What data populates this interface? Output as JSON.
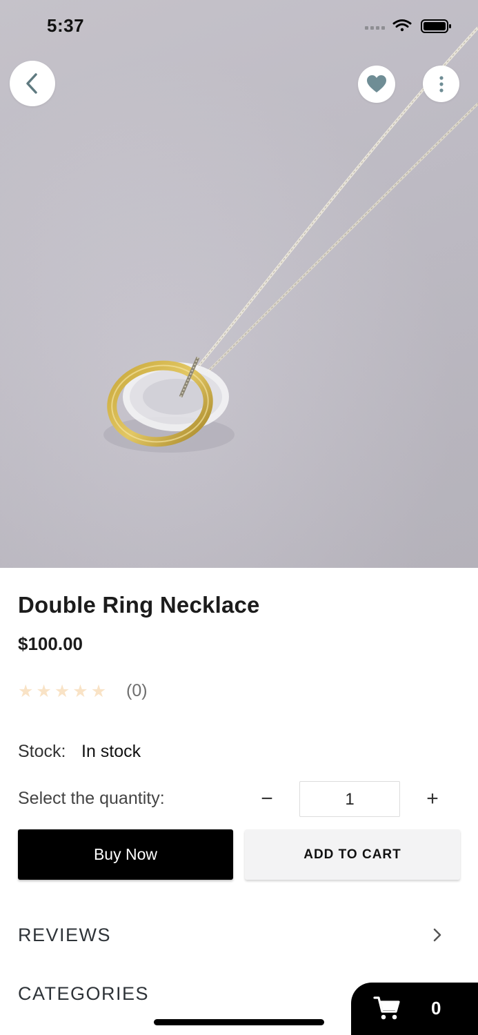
{
  "status_bar": {
    "time": "5:37"
  },
  "product": {
    "title": "Double Ring Necklace",
    "price": "$100.00",
    "rating_count": "(0)",
    "stars": 0,
    "star_glyphs": [
      "★",
      "★",
      "★",
      "★",
      "★"
    ]
  },
  "stock": {
    "label": "Stock:",
    "value": "In stock"
  },
  "quantity": {
    "label": "Select the quantity:",
    "minus": "−",
    "value": "1",
    "plus": "+"
  },
  "buttons": {
    "buy_now": "Buy Now",
    "add_to_cart": "ADD TO CART"
  },
  "sections": {
    "reviews": "REVIEWS",
    "categories": "CATEGORIES"
  },
  "cart": {
    "count": "0"
  },
  "colors": {
    "accent": "#000000",
    "star_empty": "#f9e3c6",
    "cart_button_bg": "#f3f3f4"
  },
  "icons": {
    "back": "chevron-left-icon",
    "favorite": "heart-icon",
    "more": "more-vertical-icon",
    "cart": "cart-icon",
    "reviews_arrow": "chevron-right-icon"
  }
}
